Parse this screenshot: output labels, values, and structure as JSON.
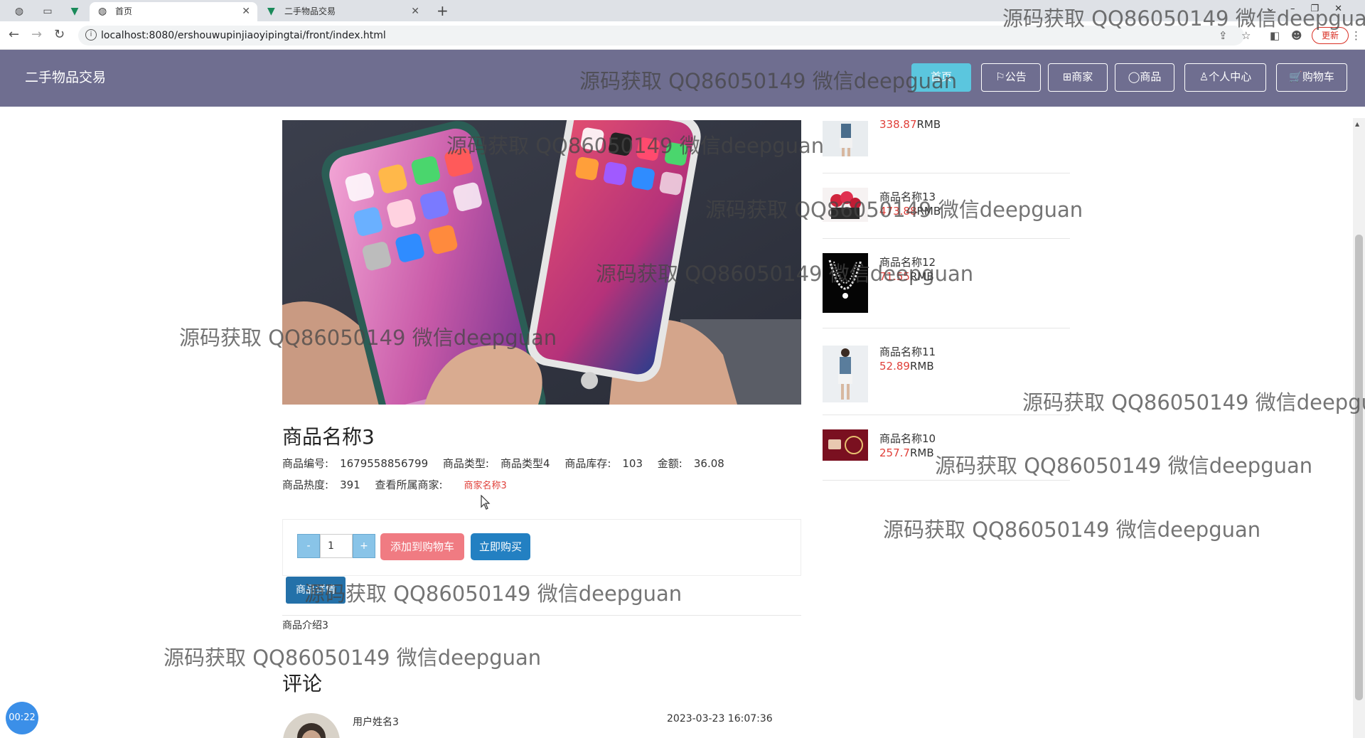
{
  "browser": {
    "tabs": [
      {
        "label": "首页",
        "active": true
      },
      {
        "label": "二手物品交易",
        "active": false
      }
    ],
    "url": "localhost:8080/ershouwupinjiaoyipingtai/front/index.html",
    "update_label": "更新"
  },
  "header": {
    "logo": "二手物品交易",
    "nav": [
      {
        "label": "首页",
        "icon": "home-icon",
        "active": true
      },
      {
        "label": "⚐公告",
        "icon": "flag-icon",
        "active": false
      },
      {
        "label": "⊞商家",
        "icon": "store-icon",
        "active": false
      },
      {
        "label": "◯商品",
        "icon": "product-icon",
        "active": false
      },
      {
        "label": "♙个人中心",
        "icon": "user-icon",
        "active": false
      },
      {
        "label": "🛒购物车",
        "icon": "cart-icon",
        "active": false
      }
    ]
  },
  "product": {
    "title": "商品名称3",
    "code_label": "商品编号:",
    "code": "1679558856799",
    "type_label": "商品类型:",
    "type": "商品类型4",
    "stock_label": "商品库存:",
    "stock": "103",
    "amount_label": "金额:",
    "amount": "36.08",
    "heat_label": "商品热度:",
    "heat": "391",
    "seller_label": "查看所属商家:",
    "seller": "商家名称3",
    "quantity": "1",
    "minus": "-",
    "plus": "+",
    "add_to_cart": "添加到购物车",
    "buy_now": "立即购买",
    "detail_tab": "商品详情",
    "detail_text": "商品介绍3"
  },
  "comments": {
    "title": "评论",
    "items": [
      {
        "user": "用户姓名3",
        "time": "2023-03-23 16:07:36"
      }
    ]
  },
  "sidebar": {
    "items": [
      {
        "name": "",
        "price": "338.87",
        "unit": "RMB"
      },
      {
        "name": "商品名称13",
        "price": "473.88",
        "unit": "RMB"
      },
      {
        "name": "商品名称12",
        "price": "71.55",
        "unit": "RMB"
      },
      {
        "name": "商品名称11",
        "price": "52.89",
        "unit": "RMB"
      },
      {
        "name": "商品名称10",
        "price": "257.7",
        "unit": "RMB"
      }
    ]
  },
  "timer": "00:22",
  "watermark": "源码获取 QQ86050149 微信deepguan",
  "colors": {
    "header_bg": "#6f6e90",
    "active_nav": "#5bc6de",
    "price_red": "#e0403a",
    "buy_blue": "#2380c2",
    "cart_pink": "#f07b82"
  }
}
